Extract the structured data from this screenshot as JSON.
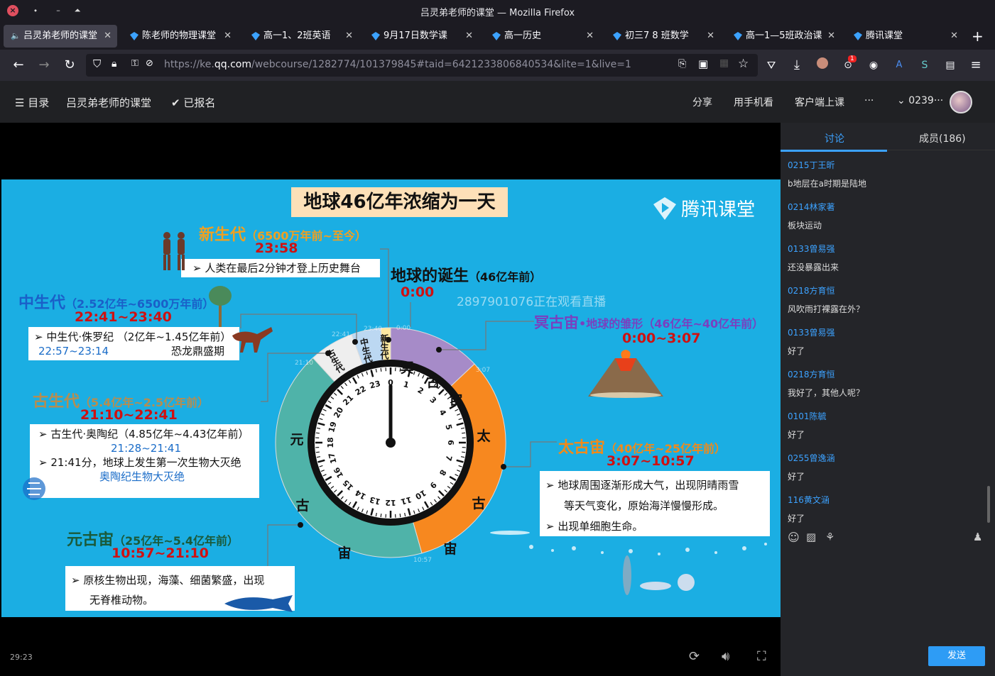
{
  "window": {
    "title": "吕灵弟老师的课堂 — Mozilla Firefox"
  },
  "tabs": [
    {
      "label": "吕灵弟老师的课堂"
    },
    {
      "label": "陈老师的物理课堂"
    },
    {
      "label": "高一1、2班英语"
    },
    {
      "label": "9月17日数学课"
    },
    {
      "label": "高一历史"
    },
    {
      "label": "初三7 8 班数学"
    },
    {
      "label": "高一1—5班政治课"
    },
    {
      "label": "腾讯课堂"
    }
  ],
  "address": {
    "prefix": "https://ke.",
    "domain": "qq.com",
    "rest": "/webcourse/1282774/101379845#taid=6421233806840534&lite=1&live=1"
  },
  "extensions": {
    "badge": "1"
  },
  "header": {
    "menu": "目录",
    "course": "吕灵弟老师的课堂",
    "enrolled": "已报名",
    "share": "分享",
    "mobile": "用手机看",
    "client": "客户端上课",
    "more": "···",
    "user": "0239···"
  },
  "slide": {
    "title": "地球46亿年浓缩为一天",
    "brand": "腾讯课堂",
    "watermark": "2897901076正在观看直播",
    "cenozoic": {
      "name": "新生代",
      "range": "（6500万年前~至今）",
      "time": "23:58",
      "note": "➢ 人类在最后2分钟才登上历史舞台"
    },
    "birth": {
      "name": "地球的诞生",
      "range": "（46亿年前）",
      "time": "0:00"
    },
    "mesozoic": {
      "name": "中生代",
      "range": "（2.52亿年~6500万年前）",
      "time": "22:41~23:40",
      "note1": "➢ 中生代·侏罗纪 （2亿年~1.45亿年前）",
      "note2": "22:57~23:14",
      "note3": "恐龙鼎盛期"
    },
    "hadean": {
      "name": "冥古宙",
      "extra": "•地球的雏形",
      "range": "（46亿年~40亿年前）",
      "time": "0:00~3:07"
    },
    "paleozoic": {
      "name": "古生代",
      "range": "（5.4亿年~2.5亿年前）",
      "time": "21:10~22:41",
      "note1": "➢ 古生代·奥陶纪（4.85亿年~4.43亿年前）",
      "note2": "21:28~21:41",
      "note3": "➢ 21:41分，地球上发生第一次生物大灭绝",
      "note4": "奥陶纪生物大灭绝"
    },
    "archean": {
      "name": "太古宙",
      "range": "（40亿年~25亿年前）",
      "time": "3:07~10:57",
      "note1": "➢   地球周围逐渐形成大气，出现阴晴雨雪",
      "note2": "等天气变化，原始海洋慢慢形成。",
      "note3": "➢   出现单细胞生命。"
    },
    "proterozoic": {
      "name": "元古宙",
      "range": "（25亿年~5.4亿年前）",
      "time": "10:57~21:10",
      "note1": "➢   原核生物出现，海藻、细菌繁盛，出现",
      "note2": "无脊椎动物。"
    },
    "ring": {
      "hadean1": "冥",
      "hadean2": "古",
      "hadean3": "宙",
      "archean1": "太",
      "archean2": "古",
      "archean3": "宙",
      "pro1": "元",
      "pro2": "古",
      "pro3": "宙",
      "pal": "古生代",
      "mes": "中生代",
      "cen": "新生代"
    },
    "ring_labels": {
      "t1": "23:40",
      "t2": "22:41",
      "t3": "21:10",
      "t4": "3:07",
      "t5": "10:57",
      "t6": "0:00"
    }
  },
  "player": {
    "time": "29:23"
  },
  "side": {
    "tab_discuss": "讨论",
    "tab_members": "成员(186)",
    "messages": [
      {
        "name": "0215丁王昕",
        "text": "b地层在a时期是陆地"
      },
      {
        "name": "0214林家著",
        "text": "板块运动"
      },
      {
        "name": "0133曾易强",
        "text": "还没暴露出来"
      },
      {
        "name": "0218方育恒",
        "text": "风吹雨打裸露在外？"
      },
      {
        "name": "0133曾易强",
        "text": "好了"
      },
      {
        "name": "0218方育恒",
        "text": "我好了，其他人呢？"
      },
      {
        "name": "0101陈毓",
        "text": "好了"
      },
      {
        "name": "0255曾逸涵",
        "text": "好了"
      },
      {
        "name": "116黄文涵",
        "text": "好了"
      }
    ],
    "send": "发送"
  },
  "colors": {
    "accent": "#3ca2ff",
    "slide_bg": "#1baee3",
    "hadean": "#a68bc8",
    "archean": "#f7881f",
    "proterozoic": "#4fb3a9"
  }
}
